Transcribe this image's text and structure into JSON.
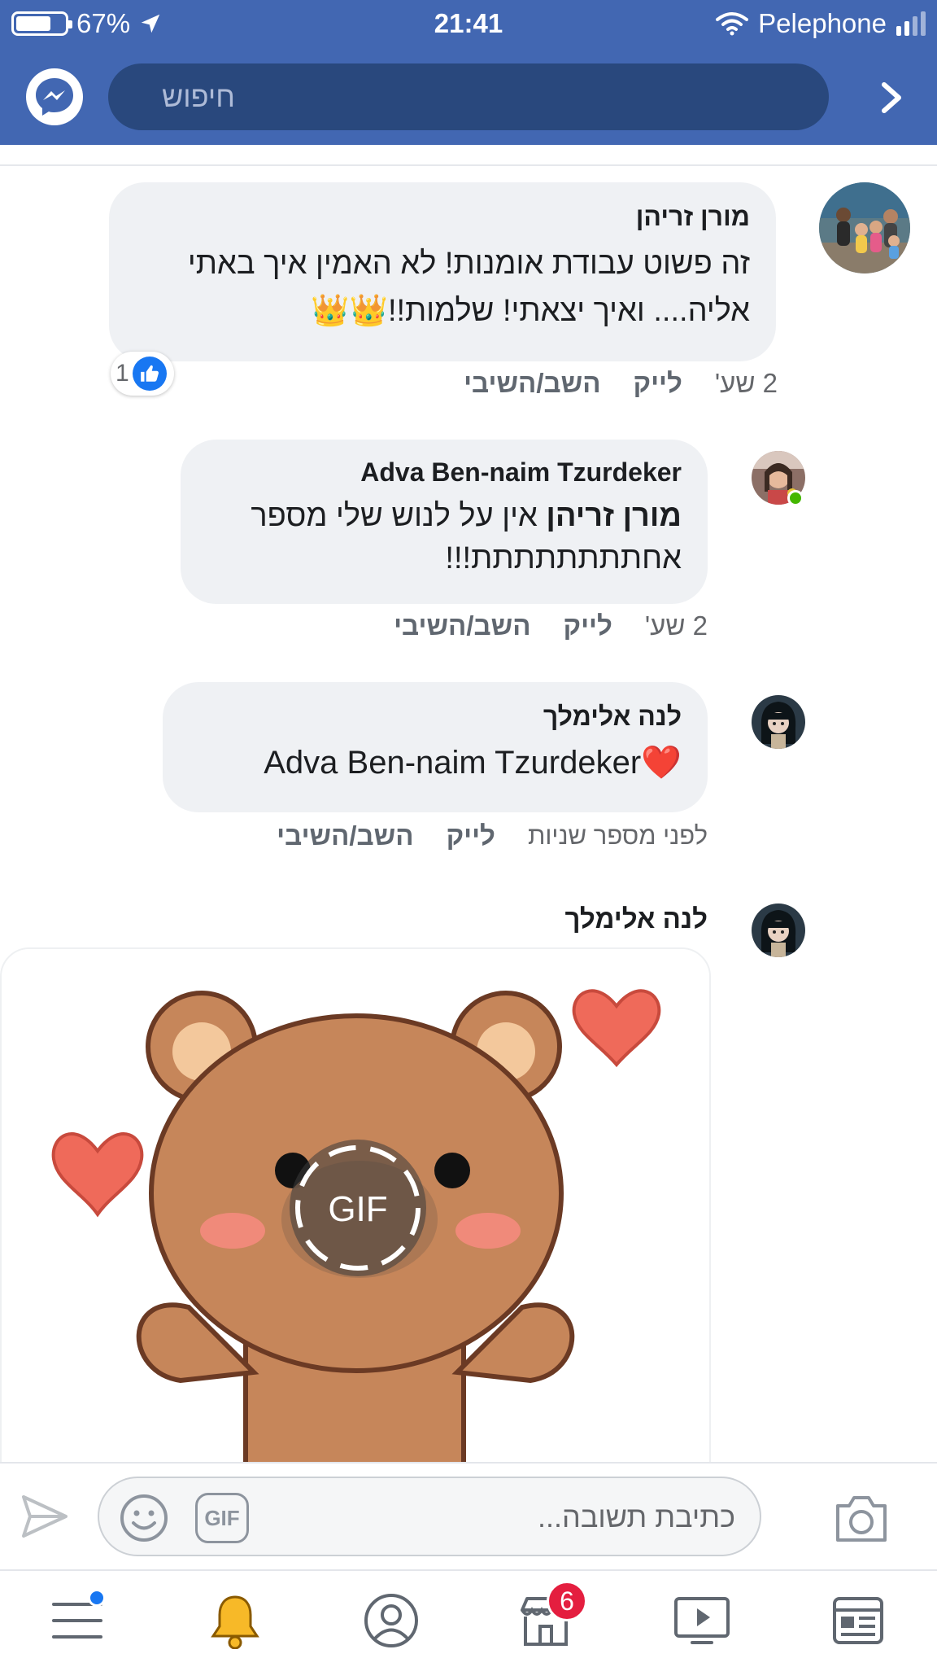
{
  "status_bar": {
    "battery": "67%",
    "time": "21:41",
    "carrier": "Pelephone"
  },
  "header": {
    "search_placeholder": "חיפוש"
  },
  "comments": [
    {
      "author": "מורן זריהן",
      "text_line1": "זה פשוט עבודת אומנות! לא האמין איך באתי",
      "text_line2": "אליה.... ואיך יצאתי!   שלמות!!👑👑",
      "time": "2 שע'",
      "like_label": "לייק",
      "reply_label": "השב/השיבי",
      "like_count": "1"
    },
    {
      "author": "Adva Ben-naim Tzurdeker",
      "mention": "מורן זריהן",
      "text_line1": "אין על לנוש שלי מספר",
      "text_line2": "אחתתתתתתתת!!!",
      "time": "2 שע'",
      "like_label": "לייק",
      "reply_label": "השב/השיבי"
    },
    {
      "author": "לנה אלימלך",
      "text": "Adva Ben-naim Tzurdeker",
      "heart": "❤️",
      "time": "לפני מספר שניות",
      "like_label": "לייק",
      "reply_label": "השב/השיבי"
    },
    {
      "author": "לנה אלימלך",
      "gif_label": "GIF"
    }
  ],
  "reply_bar": {
    "placeholder": "כתיבת תשובה...",
    "gif_button": "GIF"
  },
  "bottom_nav": {
    "marketplace_badge": "6"
  },
  "colors": {
    "brand_blue": "#4267b2",
    "search_pill": "#29487d",
    "bubble": "#eff1f4",
    "like_blue": "#1877f2",
    "badge_red": "#e41e3f"
  },
  "icons": [
    "location-arrow-icon",
    "wifi-icon",
    "messenger-icon",
    "chevron-right-icon",
    "like-thumb-icon",
    "send-icon",
    "emoji-icon",
    "camera-icon",
    "menu-icon",
    "bell-icon",
    "profile-icon",
    "marketplace-icon",
    "watch-icon",
    "news-feed-icon"
  ]
}
